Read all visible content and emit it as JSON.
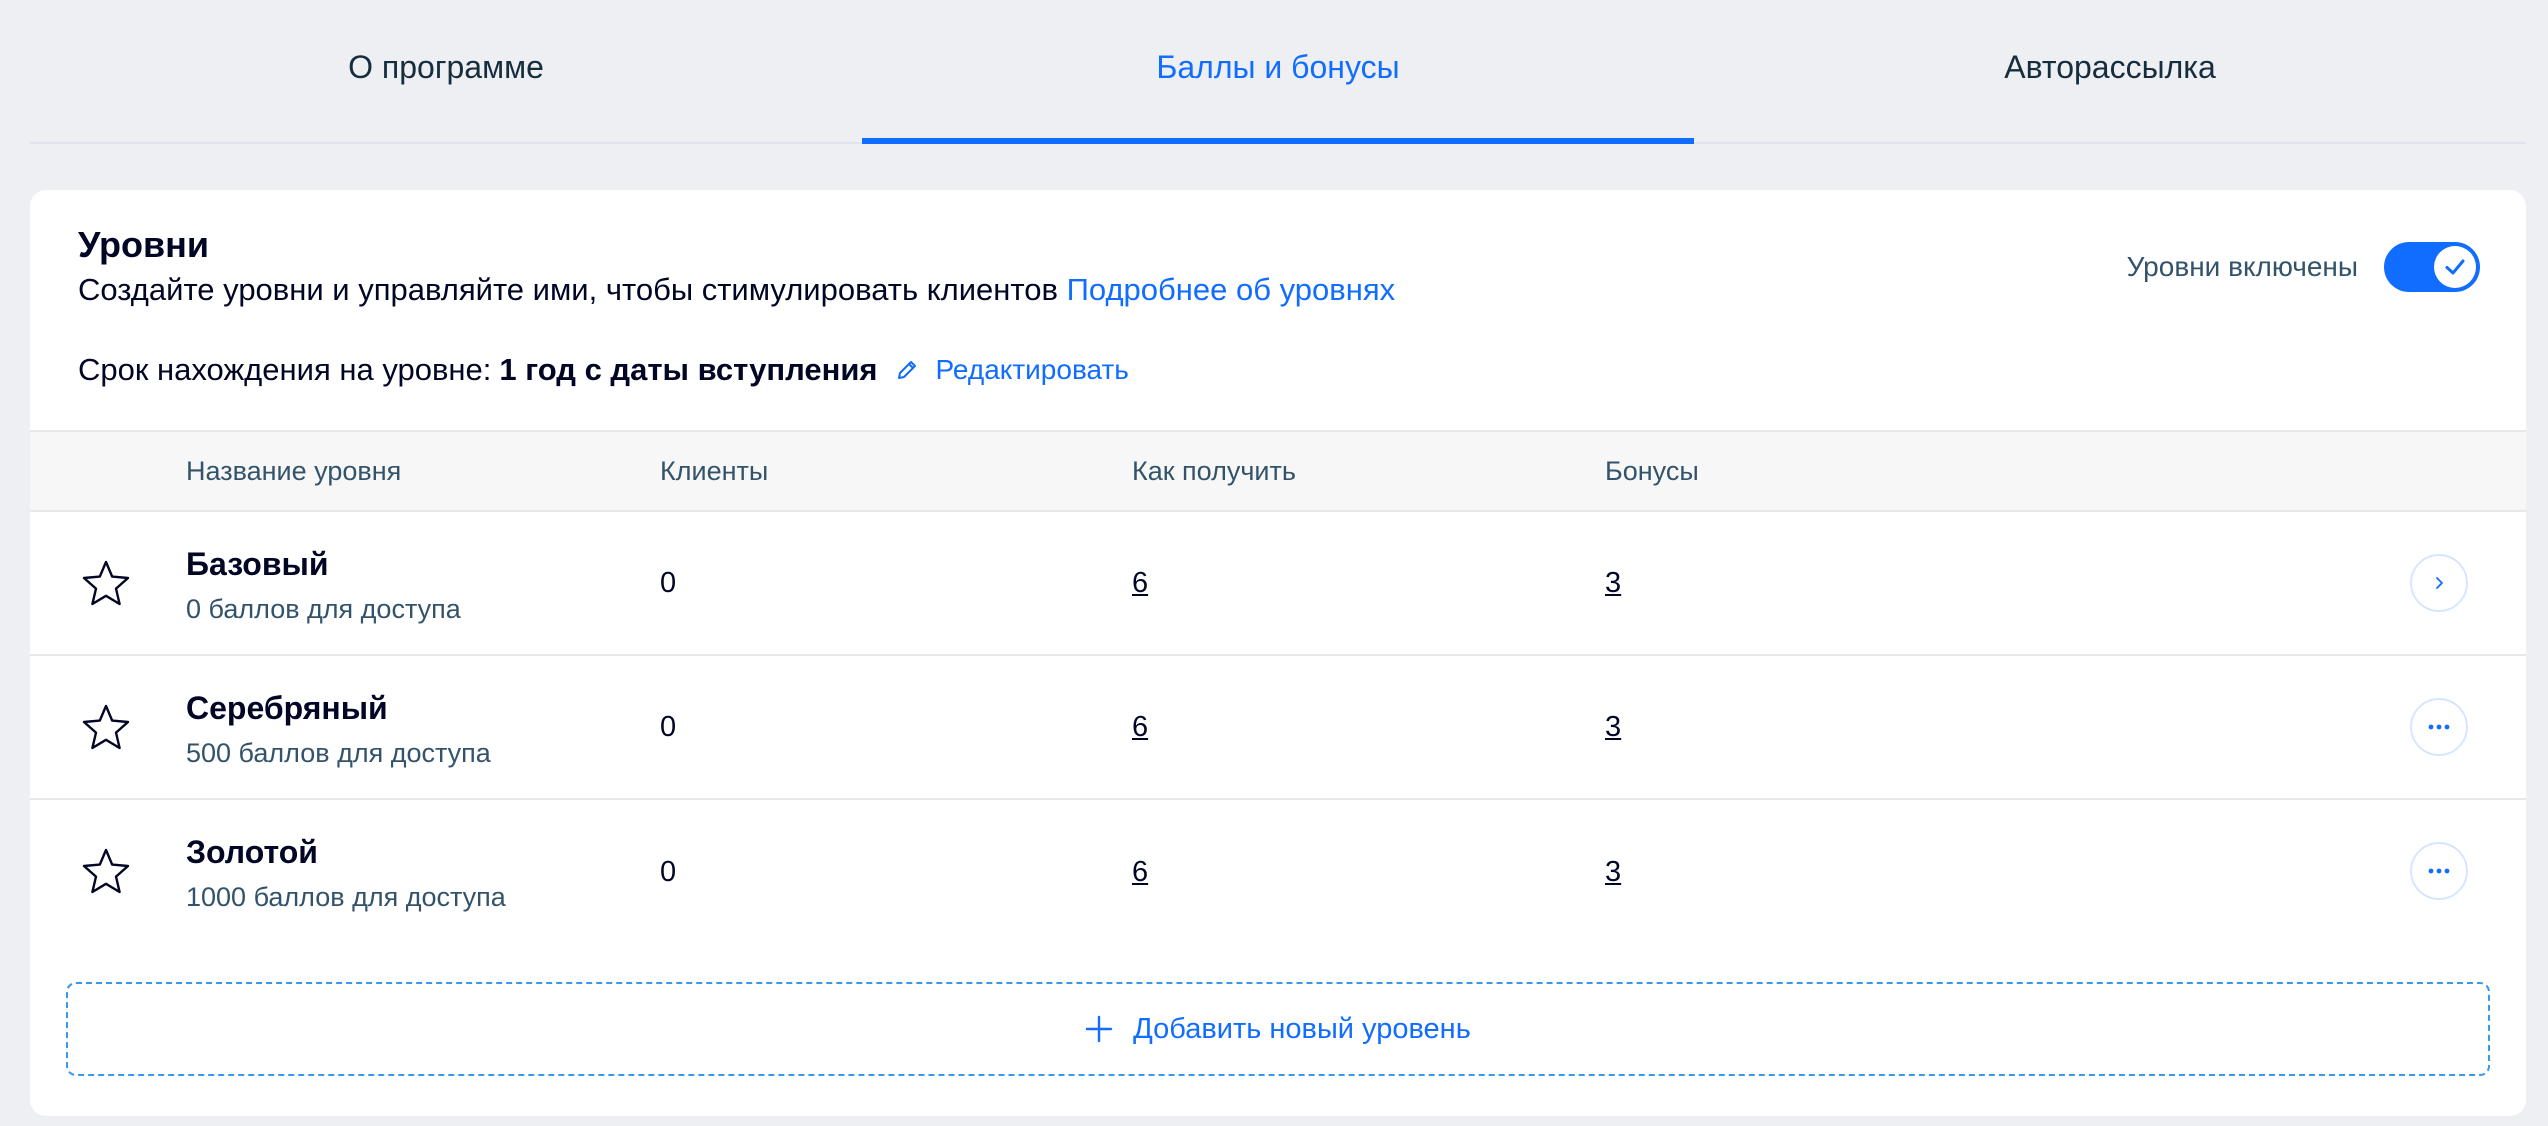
{
  "tabs": [
    {
      "label": "О программе",
      "active": false
    },
    {
      "label": "Баллы и бонусы",
      "active": true
    },
    {
      "label": "Авторассылка",
      "active": false
    }
  ],
  "levels_card": {
    "title": "Уровни",
    "subtitle": "Создайте уровни и управляйте ими, чтобы стимулировать клиентов",
    "learn_more_link": "Подробнее об уровнях",
    "toggle_label": "Уровни включены",
    "toggle_on": true,
    "duration_label": "Срок нахождения на уровне:",
    "duration_value": "1 год с даты вступления",
    "edit_label": "Редактировать"
  },
  "table": {
    "columns": [
      "Название уровня",
      "Клиенты",
      "Как получить",
      "Бонусы"
    ],
    "rows": [
      {
        "name": "Базовый",
        "desc": "0 баллов для доступа",
        "clients": "0",
        "how_to_get": "6",
        "bonuses": "3",
        "action_icon": "chevron-right-icon"
      },
      {
        "name": "Серебряный",
        "desc": "500 баллов для доступа",
        "clients": "0",
        "how_to_get": "6",
        "bonuses": "3",
        "action_icon": "more-icon"
      },
      {
        "name": "Золотой",
        "desc": "1000 баллов для доступа",
        "clients": "0",
        "how_to_get": "6",
        "bonuses": "3",
        "action_icon": "more-icon"
      }
    ]
  },
  "add_level_label": "Добавить новый уровень",
  "colors": {
    "accent": "#116dff",
    "background": "#eeeff3",
    "text": "#000624"
  }
}
